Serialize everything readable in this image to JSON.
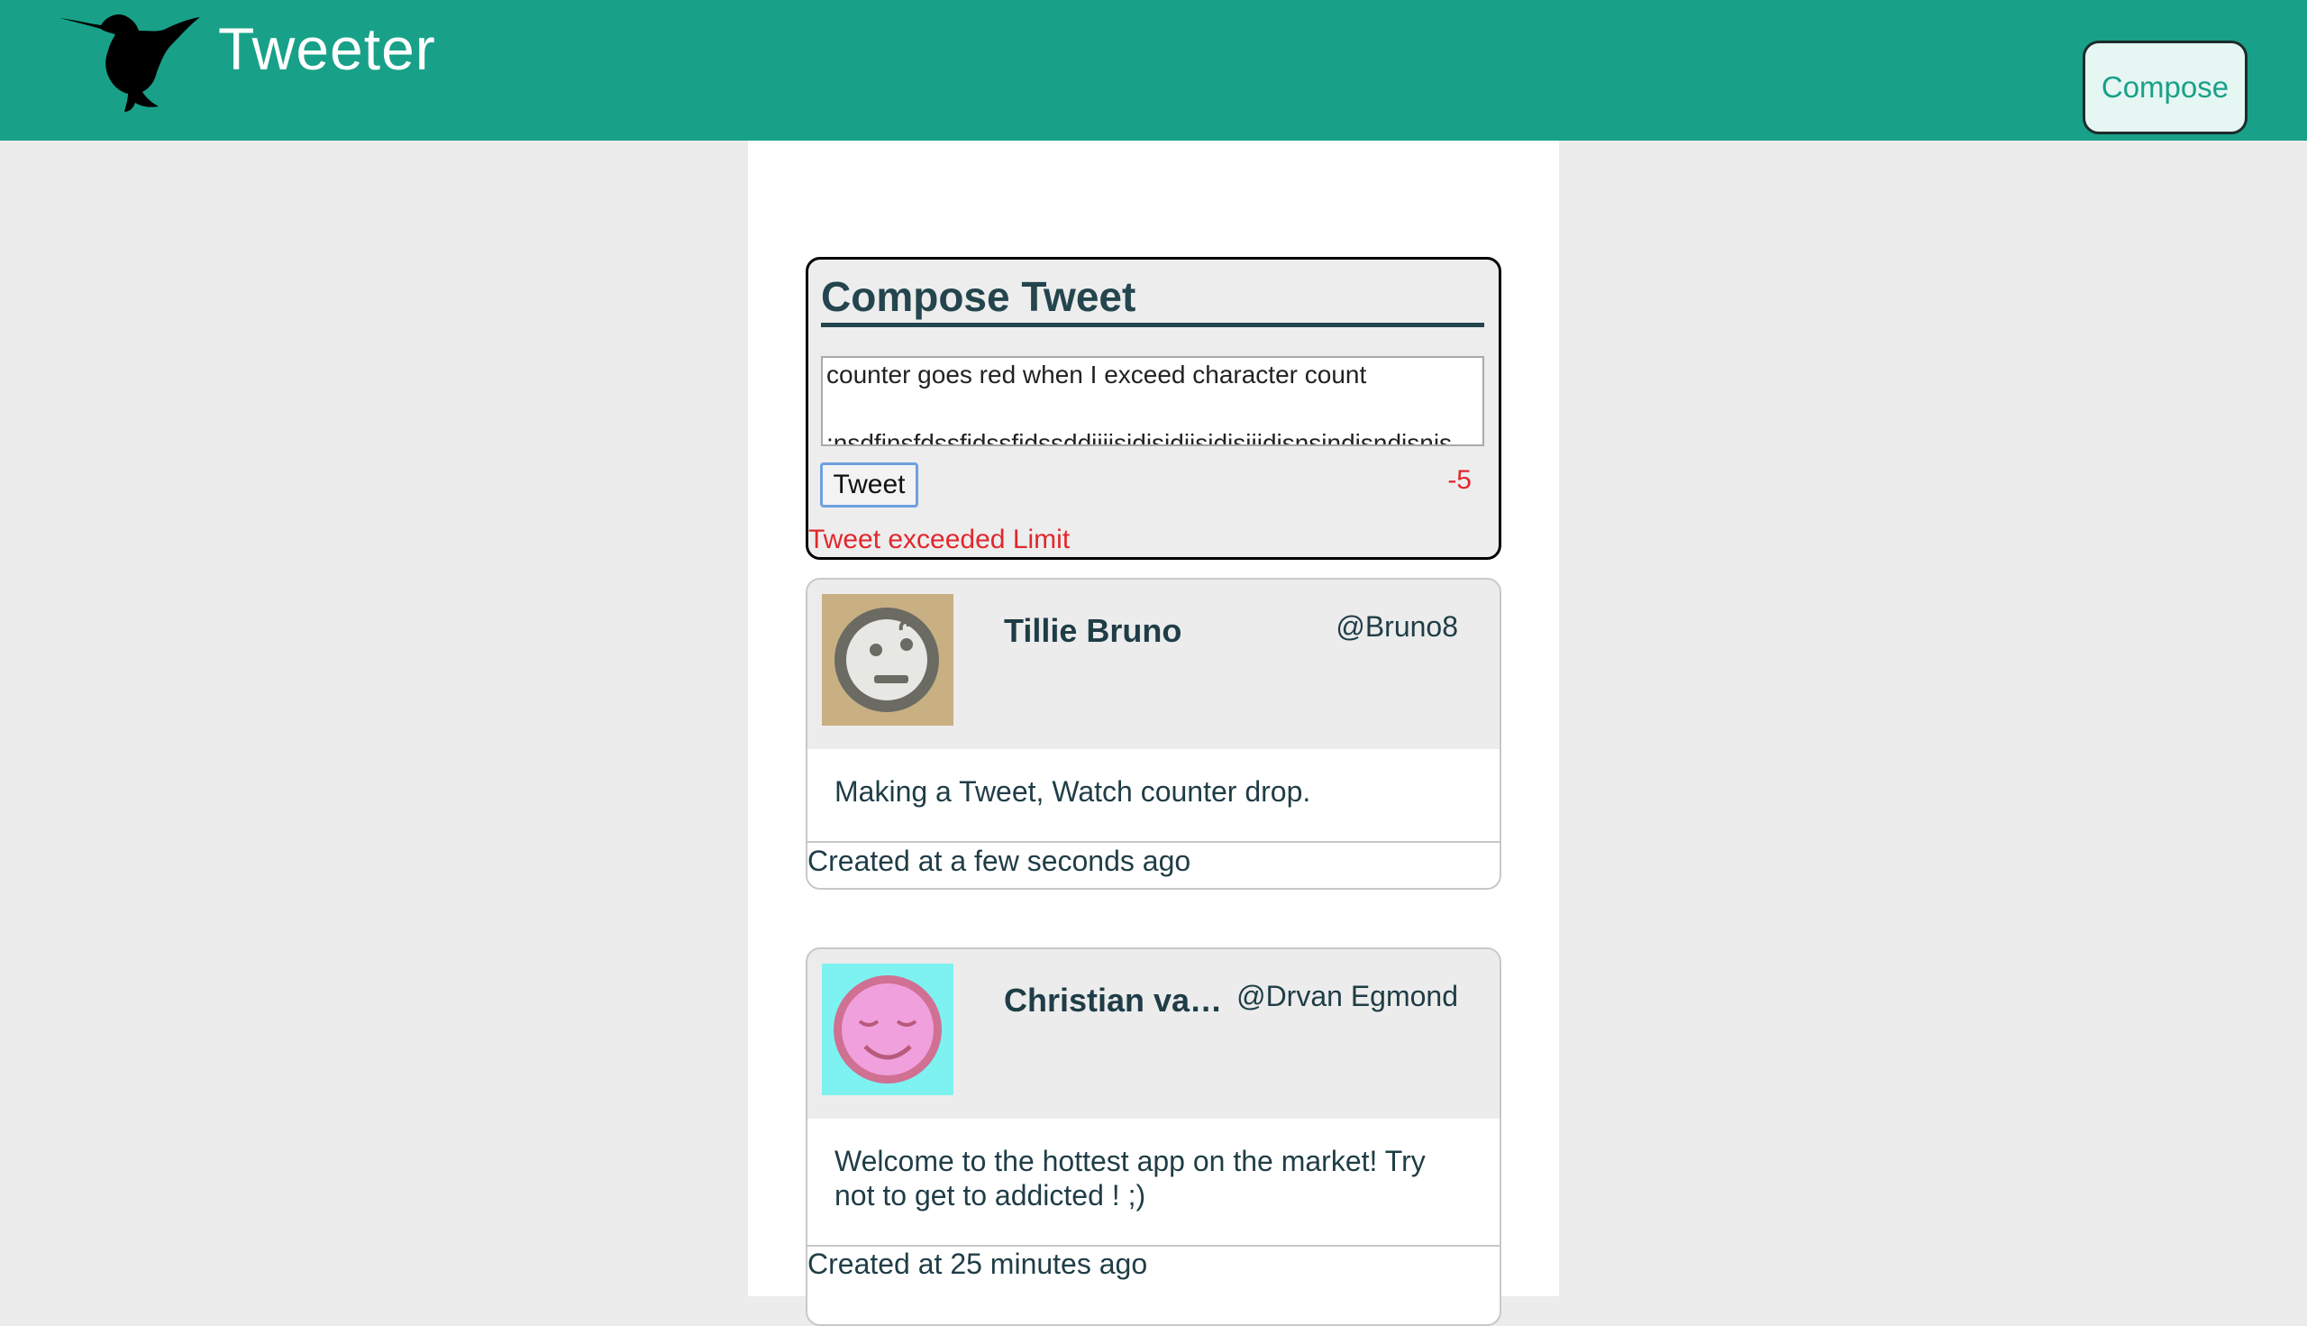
{
  "header": {
    "app_title": "Tweeter",
    "compose_label": "Compose",
    "logo_icon": "hummingbird-logo",
    "brand_color": "#18a188"
  },
  "compose": {
    "heading": "Compose Tweet",
    "text": "counter goes red when I exceed character count\n\n;nsdfinsfdssfidssfidssddiiiisidisidiisidisiiidisnsindisndisnis",
    "tweet_button_label": "Tweet",
    "counter": "-5",
    "error": "Tweet exceeded Limit",
    "error_color": "#e0282d"
  },
  "tweets": [
    {
      "name": "Tillie Bruno",
      "handle": "@Bruno8",
      "content": "Making a Tweet, Watch counter drop.",
      "created": "Created at a few seconds ago",
      "avatar_icon": "robot-face-avatar",
      "avatar_bg": "#c8b083"
    },
    {
      "name": "Christian van E...",
      "handle": "@Drvan Egmond",
      "content": "Welcome to the hottest app on the market! Try not to get to addicted ! ;)",
      "created": "Created at 25 minutes ago",
      "avatar_icon": "smiling-face-avatar",
      "avatar_bg": "#7ef2f0"
    }
  ]
}
